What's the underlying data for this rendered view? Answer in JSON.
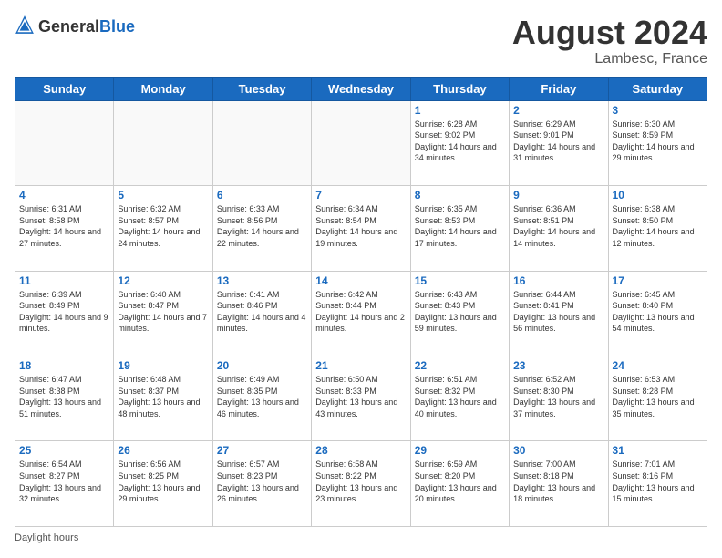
{
  "header": {
    "logo_general": "General",
    "logo_blue": "Blue",
    "month_title": "August 2024",
    "location": "Lambesc, France"
  },
  "calendar": {
    "days_of_week": [
      "Sunday",
      "Monday",
      "Tuesday",
      "Wednesday",
      "Thursday",
      "Friday",
      "Saturday"
    ],
    "weeks": [
      [
        {
          "day": "",
          "info": ""
        },
        {
          "day": "",
          "info": ""
        },
        {
          "day": "",
          "info": ""
        },
        {
          "day": "",
          "info": ""
        },
        {
          "day": "1",
          "info": "Sunrise: 6:28 AM\nSunset: 9:02 PM\nDaylight: 14 hours and 34 minutes."
        },
        {
          "day": "2",
          "info": "Sunrise: 6:29 AM\nSunset: 9:01 PM\nDaylight: 14 hours and 31 minutes."
        },
        {
          "day": "3",
          "info": "Sunrise: 6:30 AM\nSunset: 8:59 PM\nDaylight: 14 hours and 29 minutes."
        }
      ],
      [
        {
          "day": "4",
          "info": "Sunrise: 6:31 AM\nSunset: 8:58 PM\nDaylight: 14 hours and 27 minutes."
        },
        {
          "day": "5",
          "info": "Sunrise: 6:32 AM\nSunset: 8:57 PM\nDaylight: 14 hours and 24 minutes."
        },
        {
          "day": "6",
          "info": "Sunrise: 6:33 AM\nSunset: 8:56 PM\nDaylight: 14 hours and 22 minutes."
        },
        {
          "day": "7",
          "info": "Sunrise: 6:34 AM\nSunset: 8:54 PM\nDaylight: 14 hours and 19 minutes."
        },
        {
          "day": "8",
          "info": "Sunrise: 6:35 AM\nSunset: 8:53 PM\nDaylight: 14 hours and 17 minutes."
        },
        {
          "day": "9",
          "info": "Sunrise: 6:36 AM\nSunset: 8:51 PM\nDaylight: 14 hours and 14 minutes."
        },
        {
          "day": "10",
          "info": "Sunrise: 6:38 AM\nSunset: 8:50 PM\nDaylight: 14 hours and 12 minutes."
        }
      ],
      [
        {
          "day": "11",
          "info": "Sunrise: 6:39 AM\nSunset: 8:49 PM\nDaylight: 14 hours and 9 minutes."
        },
        {
          "day": "12",
          "info": "Sunrise: 6:40 AM\nSunset: 8:47 PM\nDaylight: 14 hours and 7 minutes."
        },
        {
          "day": "13",
          "info": "Sunrise: 6:41 AM\nSunset: 8:46 PM\nDaylight: 14 hours and 4 minutes."
        },
        {
          "day": "14",
          "info": "Sunrise: 6:42 AM\nSunset: 8:44 PM\nDaylight: 14 hours and 2 minutes."
        },
        {
          "day": "15",
          "info": "Sunrise: 6:43 AM\nSunset: 8:43 PM\nDaylight: 13 hours and 59 minutes."
        },
        {
          "day": "16",
          "info": "Sunrise: 6:44 AM\nSunset: 8:41 PM\nDaylight: 13 hours and 56 minutes."
        },
        {
          "day": "17",
          "info": "Sunrise: 6:45 AM\nSunset: 8:40 PM\nDaylight: 13 hours and 54 minutes."
        }
      ],
      [
        {
          "day": "18",
          "info": "Sunrise: 6:47 AM\nSunset: 8:38 PM\nDaylight: 13 hours and 51 minutes."
        },
        {
          "day": "19",
          "info": "Sunrise: 6:48 AM\nSunset: 8:37 PM\nDaylight: 13 hours and 48 minutes."
        },
        {
          "day": "20",
          "info": "Sunrise: 6:49 AM\nSunset: 8:35 PM\nDaylight: 13 hours and 46 minutes."
        },
        {
          "day": "21",
          "info": "Sunrise: 6:50 AM\nSunset: 8:33 PM\nDaylight: 13 hours and 43 minutes."
        },
        {
          "day": "22",
          "info": "Sunrise: 6:51 AM\nSunset: 8:32 PM\nDaylight: 13 hours and 40 minutes."
        },
        {
          "day": "23",
          "info": "Sunrise: 6:52 AM\nSunset: 8:30 PM\nDaylight: 13 hours and 37 minutes."
        },
        {
          "day": "24",
          "info": "Sunrise: 6:53 AM\nSunset: 8:28 PM\nDaylight: 13 hours and 35 minutes."
        }
      ],
      [
        {
          "day": "25",
          "info": "Sunrise: 6:54 AM\nSunset: 8:27 PM\nDaylight: 13 hours and 32 minutes."
        },
        {
          "day": "26",
          "info": "Sunrise: 6:56 AM\nSunset: 8:25 PM\nDaylight: 13 hours and 29 minutes."
        },
        {
          "day": "27",
          "info": "Sunrise: 6:57 AM\nSunset: 8:23 PM\nDaylight: 13 hours and 26 minutes."
        },
        {
          "day": "28",
          "info": "Sunrise: 6:58 AM\nSunset: 8:22 PM\nDaylight: 13 hours and 23 minutes."
        },
        {
          "day": "29",
          "info": "Sunrise: 6:59 AM\nSunset: 8:20 PM\nDaylight: 13 hours and 20 minutes."
        },
        {
          "day": "30",
          "info": "Sunrise: 7:00 AM\nSunset: 8:18 PM\nDaylight: 13 hours and 18 minutes."
        },
        {
          "day": "31",
          "info": "Sunrise: 7:01 AM\nSunset: 8:16 PM\nDaylight: 13 hours and 15 minutes."
        }
      ]
    ]
  },
  "footer": {
    "note": "Daylight hours"
  }
}
